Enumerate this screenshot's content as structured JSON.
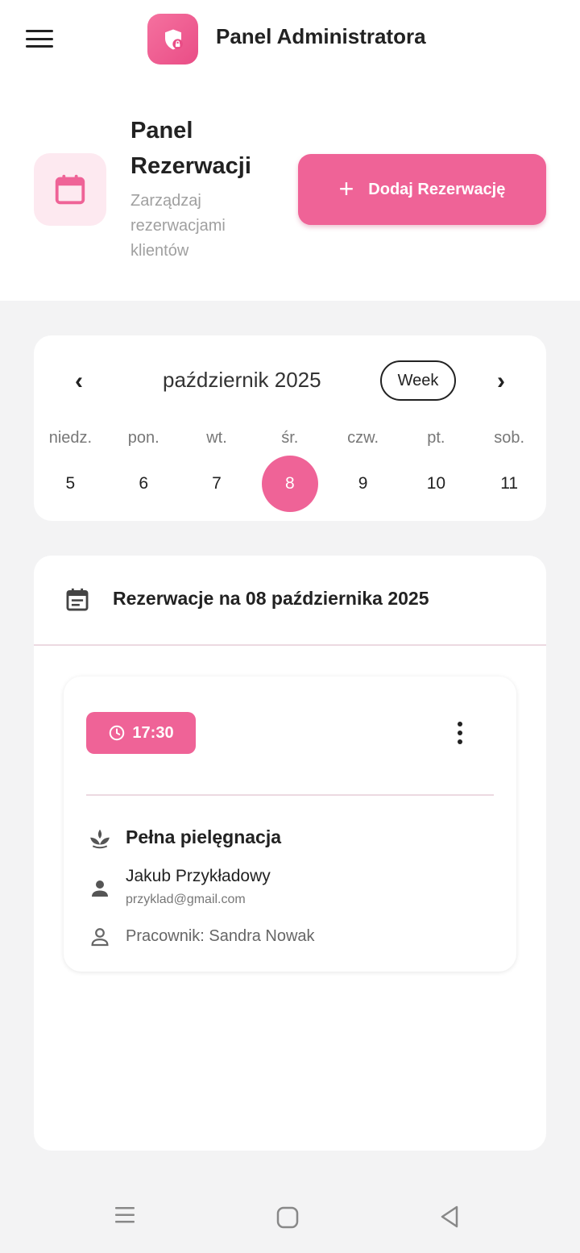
{
  "app": {
    "title": "Panel Administratora",
    "accent_color": "#ef6397"
  },
  "header": {
    "title": "Panel Rezerwacji",
    "subtitle": "Zarządzaj rezerwacjami klientów",
    "add_button_label": "Dodaj Rezerwację"
  },
  "calendar": {
    "month_label": "październik 2025",
    "view_button_label": "Week",
    "days": [
      {
        "name": "niedz.",
        "num": "5",
        "selected": false
      },
      {
        "name": "pon.",
        "num": "6",
        "selected": false
      },
      {
        "name": "wt.",
        "num": "7",
        "selected": false
      },
      {
        "name": "śr.",
        "num": "8",
        "selected": true
      },
      {
        "name": "czw.",
        "num": "9",
        "selected": false
      },
      {
        "name": "pt.",
        "num": "10",
        "selected": false
      },
      {
        "name": "sob.",
        "num": "11",
        "selected": false
      }
    ]
  },
  "reservations": {
    "heading": "Rezerwacje na 08 października 2025",
    "items": [
      {
        "time": "17:30",
        "service": "Pełna pielęgnacja",
        "client_name": "Jakub Przykładowy",
        "client_email": "przyklad@gmail.com",
        "worker": "Pracownik: Sandra Nowak"
      }
    ]
  }
}
